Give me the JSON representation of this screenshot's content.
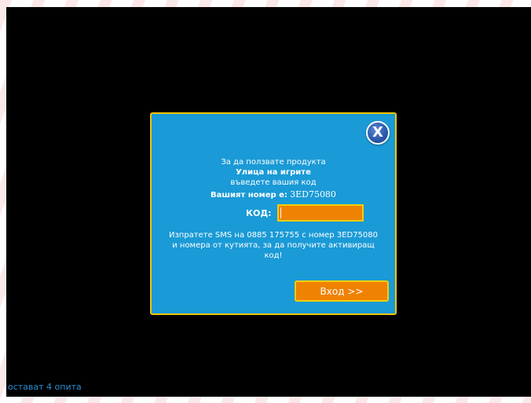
{
  "dialog": {
    "close_label": "X",
    "line1": "За да ползвате продукта",
    "product_name": "Улица на игрите",
    "line3": "въведете вашия код",
    "number_label": "Вашият номер е:",
    "number_value": "3ED75080",
    "code_label": "КОД:",
    "code_value": "",
    "sms_instructions": "Изпратете SMS на 0885 175755 с номер 3ED75080 и номера от кутията, за да получите активиращ код!",
    "login_button": "Вход >>"
  },
  "status": {
    "attempts_left": "остават 4 опита"
  },
  "colors": {
    "dialog_bg": "#1a9ad6",
    "dialog_border": "#f2c400",
    "input_bg": "#ef8200",
    "screen_bg": "#000000",
    "attempts_text": "#2a8fd6"
  },
  "icons": {
    "close": "close-icon"
  }
}
